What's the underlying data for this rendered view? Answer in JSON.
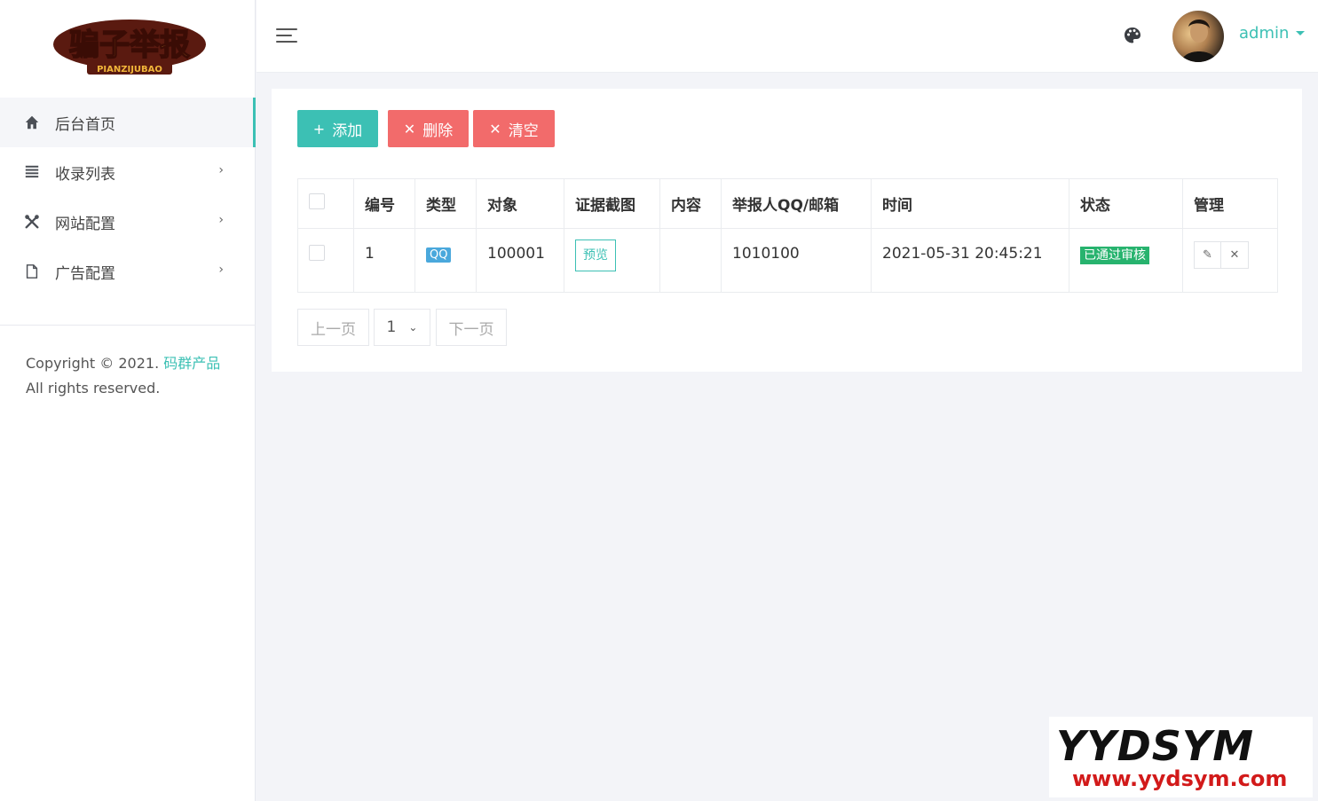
{
  "brand": {
    "logo_text": "骗子举报",
    "logo_sub": "PIANZIJUBAO"
  },
  "sidebar": {
    "items": [
      {
        "label": "后台首页",
        "icon": "home-icon",
        "active": true
      },
      {
        "label": "收录列表",
        "icon": "list-icon",
        "has_arrow": true
      },
      {
        "label": "网站配置",
        "icon": "tools-icon",
        "has_arrow": true
      },
      {
        "label": "广告配置",
        "icon": "file-icon",
        "has_arrow": true
      }
    ],
    "arrow": "›",
    "copyright_prefix": "Copyright © 2021.",
    "copyright_link": "码群产品",
    "copyright_suffix": "All rights reserved."
  },
  "header": {
    "menu_icon": "hamburger-icon",
    "theme_icon": "palette-icon",
    "username": "admin"
  },
  "toolbar": {
    "add_label": "添加",
    "delete_label": "删除",
    "clear_label": "清空",
    "add_icon": "+",
    "delete_icon": "✕",
    "clear_icon": "✕"
  },
  "table": {
    "headers": [
      "编号",
      "类型",
      "对象",
      "证据截图",
      "内容",
      "举报人QQ/邮箱",
      "时间",
      "状态",
      "管理"
    ],
    "rows": [
      {
        "id": "1",
        "type": "QQ",
        "target": "100001",
        "evidence": "预览",
        "content": "",
        "reporter": "1010100",
        "time": "2021-05-31 20:45:21",
        "status": "已通过审核"
      }
    ]
  },
  "pagination": {
    "prev": "上一页",
    "page": "1",
    "next": "下一页"
  },
  "colors": {
    "accent": "#3cc0b4",
    "danger": "#f26b6b",
    "success": "#27b36e",
    "info": "#4aa8dc"
  },
  "watermark": {
    "top": "YYDSYM",
    "bottom": "www.yydsym.com"
  }
}
